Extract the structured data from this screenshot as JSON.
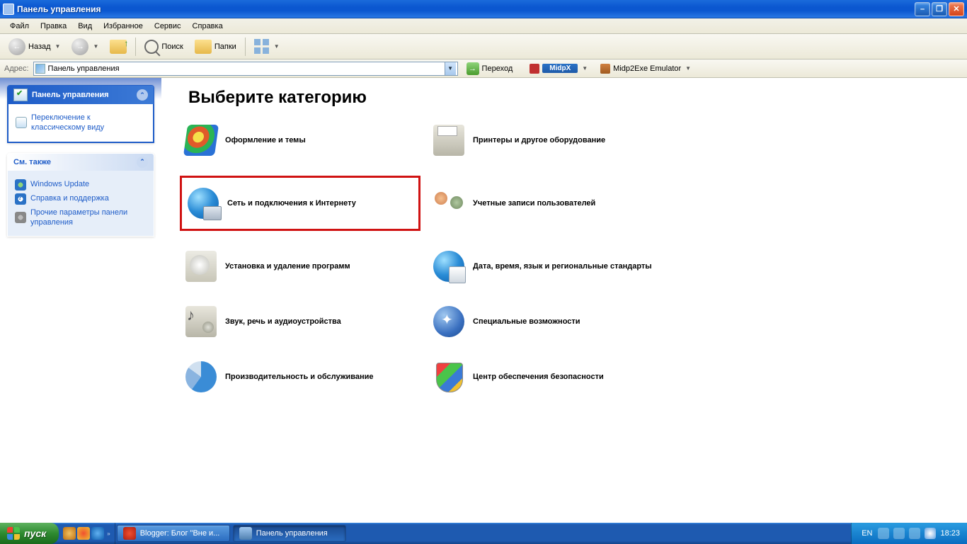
{
  "window": {
    "title": "Панель управления"
  },
  "menu": {
    "items": [
      "Файл",
      "Правка",
      "Вид",
      "Избранное",
      "Сервис",
      "Справка"
    ]
  },
  "toolbar": {
    "back": "Назад",
    "search": "Поиск",
    "folders": "Папки"
  },
  "address": {
    "label": "Адрес:",
    "value": "Панель управления",
    "go": "Переход",
    "ext1_label": "MidpX",
    "ext2_label": "Midp2Exe Emulator"
  },
  "left": {
    "boxes": [
      {
        "title": "Панель управления",
        "primary": true,
        "links": [
          {
            "icon": "mi-switch",
            "text": "Переключение к классическому виду"
          }
        ]
      },
      {
        "title": "См. также",
        "primary": false,
        "links": [
          {
            "icon": "mi-wu",
            "text": "Windows Update"
          },
          {
            "icon": "mi-help",
            "text": "Справка и поддержка"
          },
          {
            "icon": "mi-gear",
            "text": "Прочие параметры панели управления"
          }
        ]
      }
    ]
  },
  "main": {
    "heading": "Выберите категорию",
    "categories": [
      {
        "icon": "ico-appearance",
        "label": "Оформление и темы",
        "hl": false
      },
      {
        "icon": "ico-printer",
        "label": "Принтеры и другое оборудование",
        "hl": false
      },
      {
        "icon": "ico-network",
        "label": "Сеть и подключения к Интернету",
        "hl": true
      },
      {
        "icon": "ico-users",
        "label": "Учетные записи пользователей",
        "hl": false
      },
      {
        "icon": "ico-addremove",
        "label": "Установка и удаление программ",
        "hl": false
      },
      {
        "icon": "ico-datetime",
        "label": "Дата, время, язык и региональные стандарты",
        "hl": false
      },
      {
        "icon": "ico-sound",
        "label": "Звук, речь и аудиоустройства",
        "hl": false
      },
      {
        "icon": "ico-access",
        "label": "Специальные возможности",
        "hl": false
      },
      {
        "icon": "ico-perf",
        "label": "Производительность и обслуживание",
        "hl": false
      },
      {
        "icon": "ico-security",
        "label": "Центр обеспечения безопасности",
        "hl": false
      }
    ]
  },
  "taskbar": {
    "start": "пуск",
    "tasks": [
      {
        "label": "Blogger: Блог \"Вне и...",
        "active": false
      },
      {
        "label": "Панель управления",
        "active": true
      }
    ],
    "lang": "EN",
    "time": "18:23"
  }
}
